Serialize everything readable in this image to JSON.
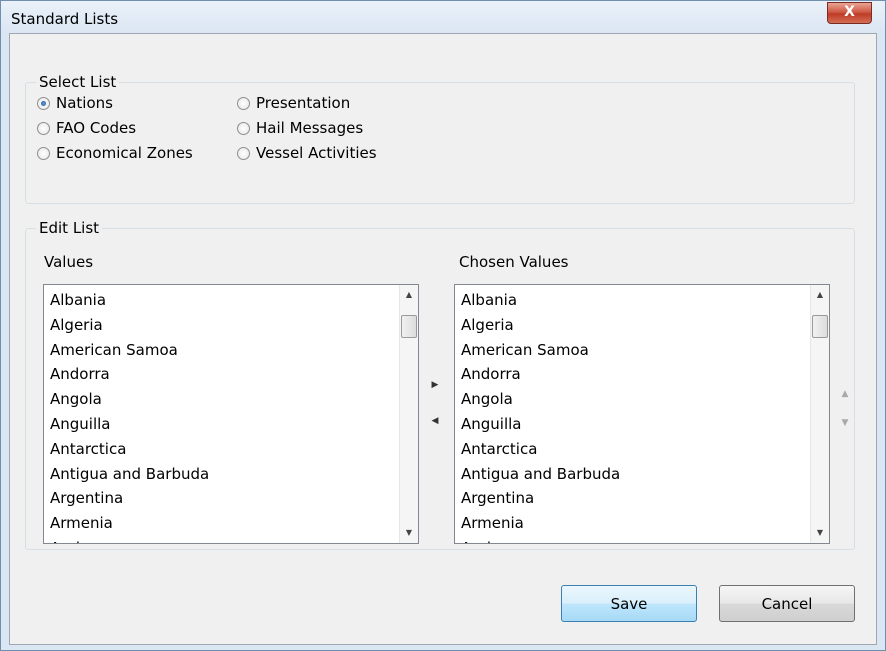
{
  "window": {
    "title": "Standard Lists",
    "close_glyph": "X"
  },
  "select_list": {
    "legend": "Select List",
    "options": [
      {
        "label": "Nations",
        "checked": true
      },
      {
        "label": "FAO Codes",
        "checked": false
      },
      {
        "label": "Economical Zones",
        "checked": false
      },
      {
        "label": "Presentation",
        "checked": false
      },
      {
        "label": "Hail Messages",
        "checked": false
      },
      {
        "label": "Vessel Activities",
        "checked": false
      }
    ]
  },
  "edit_list": {
    "legend": "Edit List",
    "values_label": "Values",
    "chosen_label": "Chosen Values",
    "values": [
      "Albania",
      "Algeria",
      "American Samoa",
      "Andorra",
      "Angola",
      "Anguilla",
      "Antarctica",
      "Antigua and Barbuda",
      "Argentina",
      "Armenia",
      "Aruba"
    ],
    "chosen_values": [
      "Albania",
      "Algeria",
      "American Samoa",
      "Andorra",
      "Angola",
      "Anguilla",
      "Antarctica",
      "Antigua and Barbuda",
      "Argentina",
      "Armenia",
      "Aruba"
    ],
    "add_glyph": "▶",
    "remove_glyph": "◀",
    "move_up_glyph": "▲",
    "move_down_glyph": "▼"
  },
  "buttons": {
    "save": "Save",
    "cancel": "Cancel"
  }
}
